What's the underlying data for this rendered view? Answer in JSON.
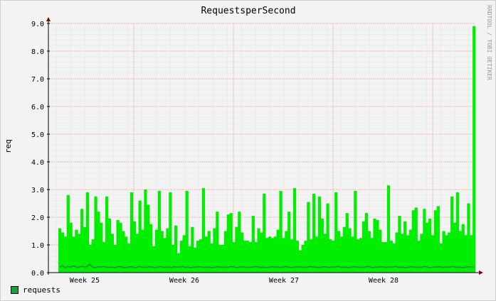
{
  "chart_data": {
    "type": "bar",
    "title": "RequestsperSecond",
    "ylabel": "req",
    "xlabel": "",
    "ylim": [
      0,
      9
    ],
    "y_ticks": [
      "0.0",
      "1.0",
      "2.0",
      "3.0",
      "4.0",
      "5.0",
      "6.0",
      "7.0",
      "8.0",
      "9.0"
    ],
    "x_ticks": [
      "Week 25",
      "Week 26",
      "Week 27",
      "Week 28"
    ],
    "grid": true,
    "watermark": "RRDTOOL / TOBI OETIKER",
    "legend_position": "bottom-left",
    "colors": {
      "area": "#00ee00",
      "line": "#1f8a3a",
      "legend_swatch": "#1aa03a",
      "grid_major": "#e8a0a0",
      "arrow": "#880000"
    },
    "series": [
      {
        "name": "requests",
        "values": [
          1.6,
          1.45,
          1.3,
          2.8,
          1.8,
          1.3,
          1.55,
          1.4,
          2.3,
          1.65,
          2.9,
          1.0,
          1.2,
          2.75,
          2.2,
          1.8,
          1.1,
          2.75,
          1.95,
          1.4,
          1.0,
          1.9,
          1.8,
          1.5,
          1.3,
          1.05,
          2.9,
          1.85,
          1.4,
          2.6,
          1.55,
          3.0,
          2.45,
          1.75,
          0.95,
          1.55,
          2.95,
          1.5,
          1.25,
          1.6,
          2.9,
          1.0,
          1.7,
          0.7,
          1.15,
          1.35,
          2.95,
          0.95,
          1.65,
          0.9,
          1.15,
          1.2,
          3.05,
          1.3,
          1.5,
          1.05,
          1.6,
          2.2,
          1.0,
          1.0,
          1.5,
          2.1,
          2.15,
          1.1,
          1.65,
          2.2,
          1.45,
          1.15,
          1.15,
          1.1,
          2.05,
          1.1,
          1.6,
          1.45,
          2.85,
          1.25,
          1.3,
          1.25,
          1.3,
          1.55,
          2.95,
          1.25,
          1.5,
          2.2,
          1.2,
          3.05,
          1.15,
          0.8,
          1.0,
          1.15,
          2.55,
          1.2,
          2.85,
          1.3,
          2.75,
          1.95,
          1.4,
          2.5,
          1.2,
          1.15,
          2.9,
          1.5,
          1.3,
          1.65,
          2.15,
          1.6,
          1.3,
          2.95,
          1.2,
          1.25,
          1.85,
          2.15,
          1.5,
          1.25,
          1.95,
          1.9,
          1.55,
          1.1,
          1.1,
          3.15,
          1.15,
          1.05,
          1.45,
          2.05,
          1.4,
          1.85,
          1.35,
          1.55,
          2.25,
          2.35,
          1.15,
          1.4,
          2.3,
          1.8,
          1.95,
          1.35,
          2.25,
          2.4,
          1.05,
          1.5,
          1.35,
          1.45,
          2.75,
          1.8,
          2.9,
          1.5,
          1.75,
          1.35,
          2.5,
          1.35,
          8.9
        ]
      },
      {
        "name": "",
        "values": [
          0.2,
          0.25,
          0.18,
          0.22,
          0.2,
          0.24,
          0.2,
          0.19,
          0.23,
          0.2,
          0.22,
          0.3,
          0.2,
          0.18,
          0.21,
          0.2,
          0.22,
          0.2,
          0.19,
          0.2,
          0.18,
          0.2,
          0.22,
          0.2,
          0.17,
          0.2,
          0.21,
          0.2,
          0.18,
          0.22,
          0.2,
          0.19,
          0.2,
          0.21,
          0.2,
          0.18,
          0.2,
          0.22,
          0.19,
          0.2,
          0.2,
          0.18,
          0.21,
          0.2,
          0.2,
          0.22,
          0.19,
          0.2,
          0.18,
          0.2,
          0.2,
          0.21,
          0.2,
          0.19,
          0.2,
          0.2,
          0.18,
          0.2,
          0.21,
          0.2,
          0.19,
          0.2,
          0.2,
          0.22,
          0.2,
          0.18,
          0.2,
          0.21,
          0.2,
          0.19,
          0.2,
          0.2,
          0.22,
          0.2,
          0.19,
          0.2,
          0.18,
          0.2,
          0.21,
          0.2,
          0.2,
          0.19,
          0.2,
          0.22,
          0.2,
          0.18,
          0.2,
          0.2,
          0.21,
          0.2,
          0.19,
          0.2,
          0.22,
          0.2,
          0.2,
          0.18,
          0.2,
          0.21,
          0.2,
          0.19,
          0.2,
          0.2,
          0.22,
          0.2,
          0.19,
          0.2,
          0.18,
          0.2,
          0.21,
          0.2,
          0.2,
          0.19,
          0.2,
          0.22,
          0.2,
          0.18,
          0.2,
          0.2,
          0.21,
          0.2,
          0.19,
          0.2,
          0.2,
          0.22,
          0.2,
          0.19,
          0.2,
          0.18,
          0.2,
          0.21,
          0.2,
          0.2,
          0.19,
          0.2,
          0.22,
          0.2,
          0.18,
          0.2,
          0.2,
          0.21,
          0.2,
          0.19,
          0.2,
          0.2,
          0.22,
          0.2,
          0.19,
          0.2,
          0.18,
          0.2,
          0.21,
          0.2,
          0.2
        ]
      }
    ]
  }
}
